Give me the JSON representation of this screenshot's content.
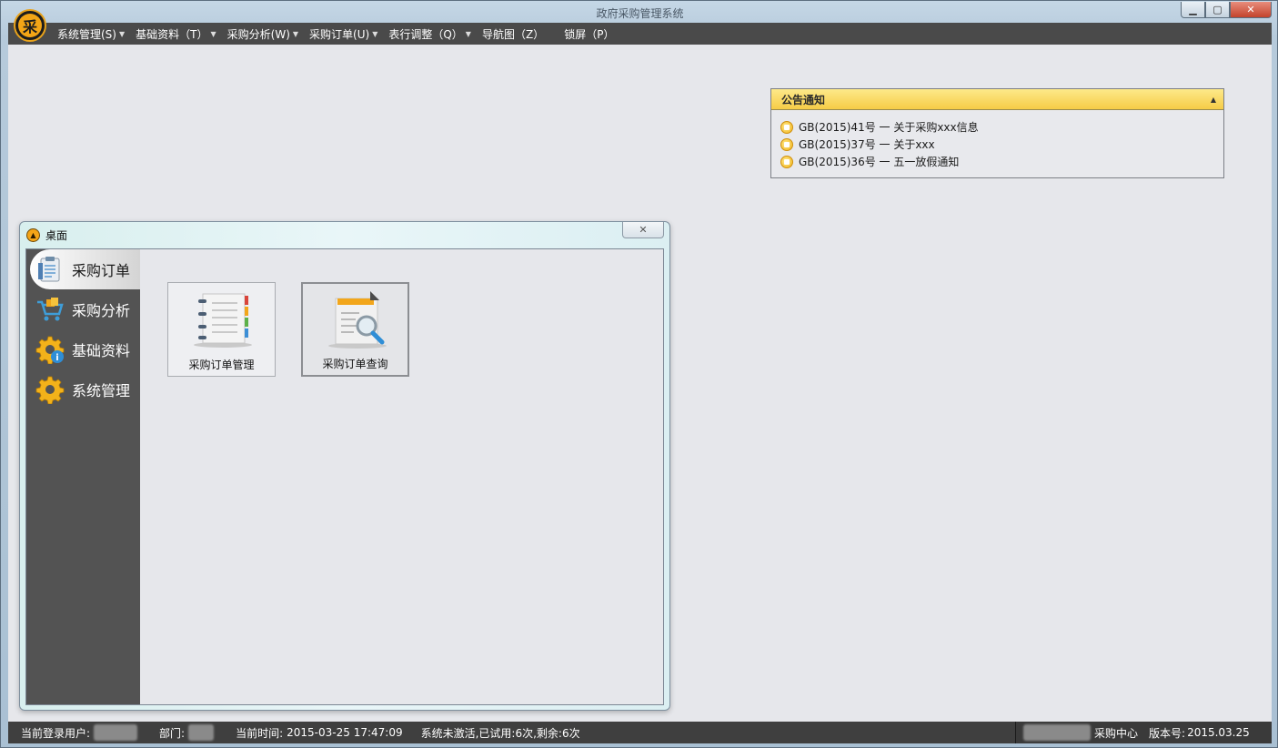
{
  "window": {
    "title": "政府采购管理系统",
    "logo_char": "采",
    "minimize": "▁",
    "maximize": "▢",
    "close": "✕"
  },
  "menu": [
    {
      "label": "系统管理(S)",
      "has_caret": true
    },
    {
      "label": "基础资料（T）",
      "has_caret": true
    },
    {
      "label": "采购分析(W)",
      "has_caret": true
    },
    {
      "label": "采购订单(U)",
      "has_caret": true
    },
    {
      "label": "表行调整（Q）",
      "has_caret": true
    },
    {
      "label": "导航图（Z）",
      "has_caret": false
    },
    {
      "label": "锁屏（P）",
      "has_caret": false
    }
  ],
  "notice": {
    "title": "公告通知",
    "items": [
      "GB(2015)41号 一 关于采购xxx信息",
      "GB(2015)37号 一 关于xxx",
      "GB(2015)36号 一 五一放假通知"
    ]
  },
  "desk": {
    "title": "桌面",
    "close": "✕",
    "sidebar": [
      {
        "label": "采购订单",
        "icon": "clipboard-icon",
        "active": true
      },
      {
        "label": "采购分析",
        "icon": "cart-icon",
        "active": false
      },
      {
        "label": "基础资料",
        "icon": "gear-info-icon",
        "active": false
      },
      {
        "label": "系统管理",
        "icon": "gear-icon",
        "active": false
      }
    ],
    "tiles": [
      {
        "label": "采购订单管理",
        "icon": "notebook-icon",
        "selected": false
      },
      {
        "label": "采购订单查询",
        "icon": "document-search-icon",
        "selected": true
      }
    ]
  },
  "status": {
    "user_label": "当前登录用户:",
    "dept_label": "部门:",
    "time_label": "当前时间:",
    "time_value": "2015-03-25 17:47:09",
    "activation": "系统未激活,已试用:6次,剩余:6次",
    "center": "采购中心",
    "version_label": "版本号:",
    "version_value": "2015.03.25"
  },
  "colors": {
    "accent": "#f4a417",
    "menubar": "#4a4a4a",
    "sidebar": "#535353",
    "notice_header": "#f6cc46"
  }
}
